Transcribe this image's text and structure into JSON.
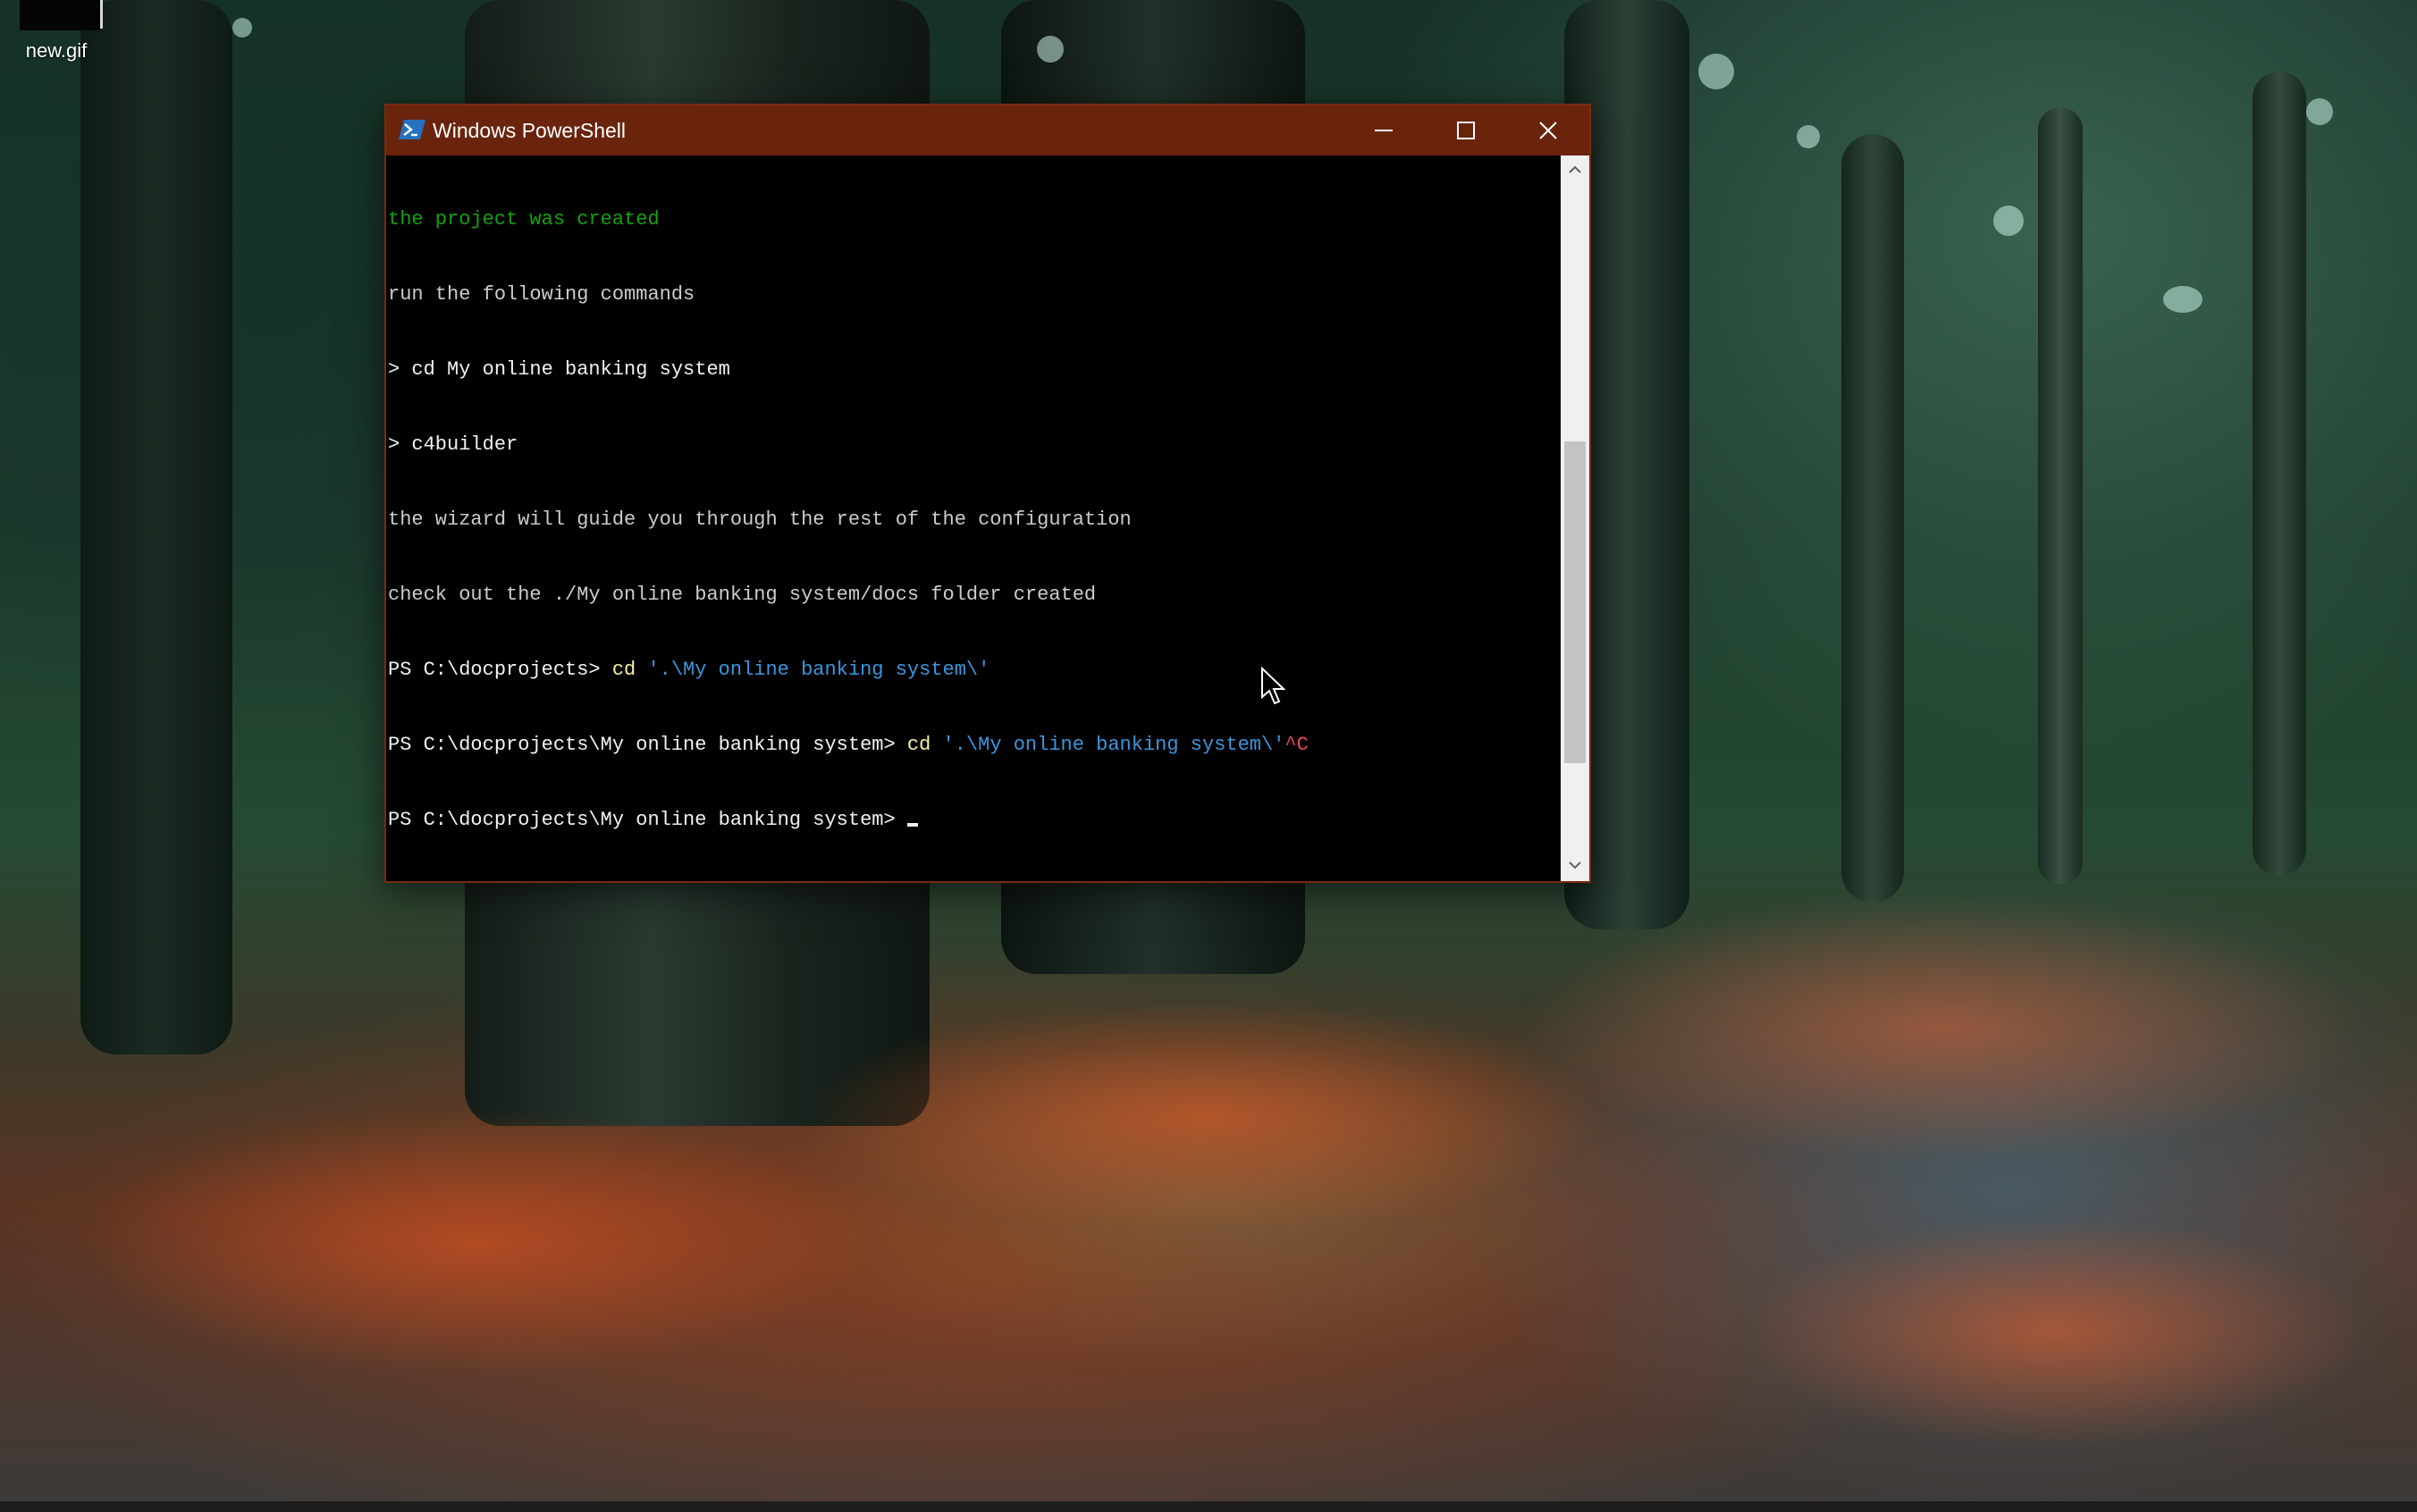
{
  "desktop": {
    "icons": [
      {
        "label": "new.gif",
        "icon": "gif-file-icon"
      }
    ]
  },
  "window": {
    "title": "Windows PowerShell",
    "app_icon": "powershell-icon",
    "controls": {
      "minimize_icon": "minimize-icon",
      "maximize_icon": "maximize-icon",
      "close_icon": "close-icon"
    },
    "accent_color": "#6b240c"
  },
  "console": {
    "lines": [
      {
        "segments": [
          {
            "text": "the project was created",
            "color": "green"
          }
        ]
      },
      {
        "segments": [
          {
            "text": "run the following commands",
            "color": "gray"
          }
        ]
      },
      {
        "segments": [
          {
            "text": "> cd My online banking system",
            "color": "white"
          }
        ]
      },
      {
        "segments": [
          {
            "text": "> c4builder",
            "color": "white"
          }
        ]
      },
      {
        "segments": [
          {
            "text": "the wizard will guide you through the rest of the configuration",
            "color": "gray"
          }
        ]
      },
      {
        "segments": [
          {
            "text": "check out the ./My online banking system/docs folder created",
            "color": "gray"
          }
        ]
      },
      {
        "segments": [
          {
            "text": "PS C:\\docprojects> ",
            "color": "white"
          },
          {
            "text": "cd",
            "color": "yellow"
          },
          {
            "text": " '.\\My online banking system\\'",
            "color": "cyan"
          }
        ]
      },
      {
        "segments": [
          {
            "text": "PS C:\\docprojects\\My online banking system> ",
            "color": "white"
          },
          {
            "text": "cd",
            "color": "yellow"
          },
          {
            "text": " '.\\My online banking system\\'",
            "color": "cyan"
          },
          {
            "text": "^C",
            "color": "red"
          }
        ]
      },
      {
        "segments": [
          {
            "text": "PS C:\\docprojects\\My online banking system> ",
            "color": "white"
          }
        ],
        "cursor": true
      }
    ]
  },
  "scrollbar": {
    "up_icon": "scroll-up-arrow-icon",
    "down_icon": "scroll-down-arrow-icon"
  }
}
